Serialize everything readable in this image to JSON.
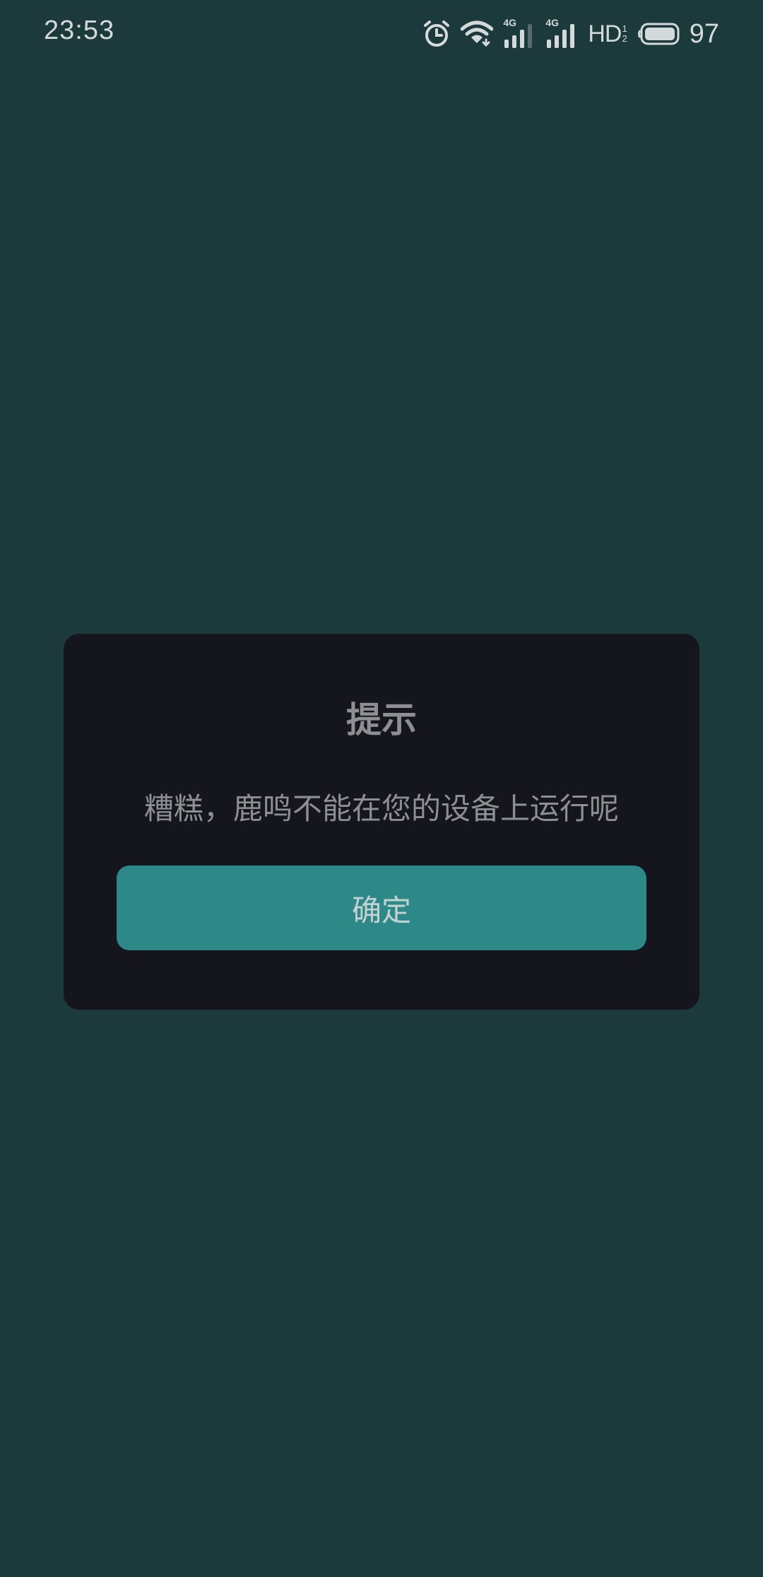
{
  "status_bar": {
    "time": "23:53",
    "icons": [
      "alarm-icon",
      "wifi-icon",
      "signal-4g-icon",
      "signal-4g-icon",
      "hd-icon",
      "battery-icon"
    ],
    "network_label_1": "4G",
    "network_label_2": "4G",
    "hd_label": "HD",
    "hd_sub": "1",
    "hd_sub2": "2",
    "battery_level": "97"
  },
  "dialog": {
    "title": "提示",
    "message": "糟糕，鹿鸣不能在您的设备上运行呢",
    "confirm_label": "确定"
  },
  "colors": {
    "background": "#1c393b",
    "dialog_bg": "#15151d",
    "button_bg": "#2d8888",
    "text_muted": "#8d8f93"
  }
}
